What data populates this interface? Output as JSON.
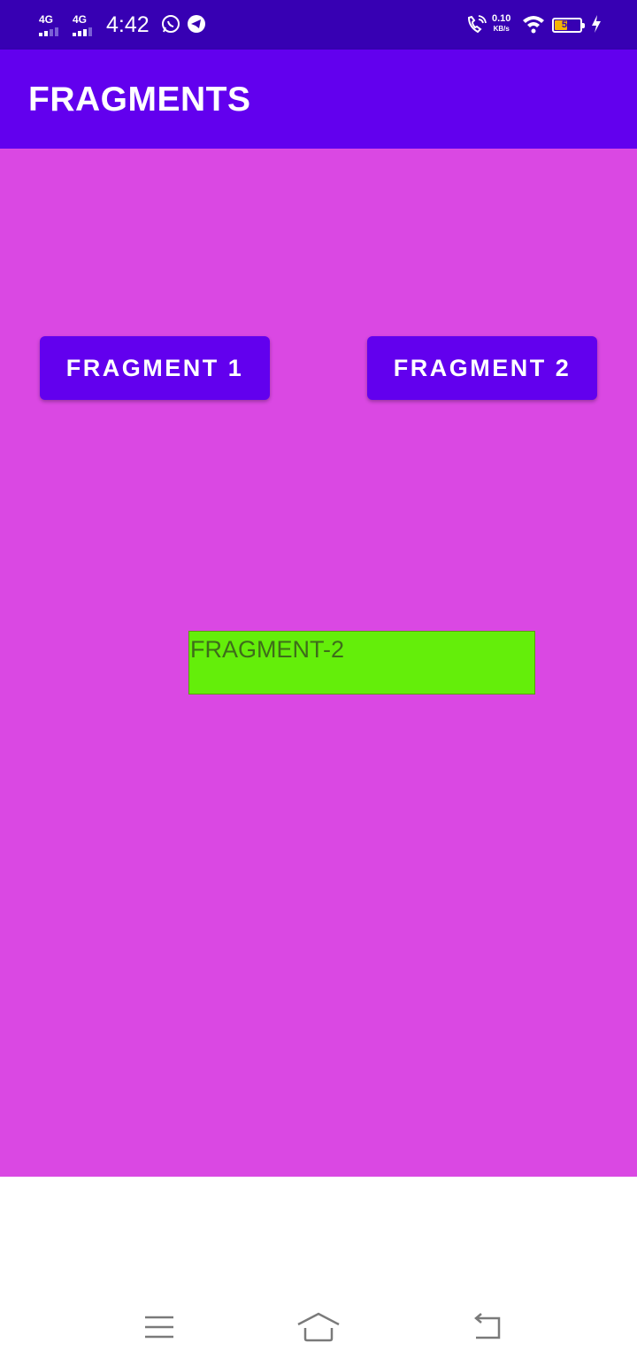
{
  "status_bar": {
    "sim1_network": "4G",
    "sim2_network": "4G",
    "time": "4:42",
    "net_speed_value": "0.10",
    "net_speed_unit": "KB/s",
    "battery_level": "52",
    "icons": [
      "whatsapp-icon",
      "telegram-icon",
      "wifi-calling-icon",
      "wifi-icon",
      "battery-icon",
      "charging-icon"
    ]
  },
  "app_bar": {
    "title": "FRAGMENTS"
  },
  "buttons": {
    "fragment1": "FRAGMENT 1",
    "fragment2": "FRAGMENT 2"
  },
  "fragment_container": {
    "text": "FRAGMENT-2"
  },
  "nav_bar": {
    "icons": [
      "menu-icon",
      "home-icon",
      "back-icon"
    ]
  },
  "colors": {
    "status_bar": "#3700b3",
    "app_bar": "#6200ee",
    "content_background": "#da48e3",
    "button": "#6200ee",
    "fragment_background": "#64ee0a",
    "fragment_text": "#3e6d1a"
  }
}
